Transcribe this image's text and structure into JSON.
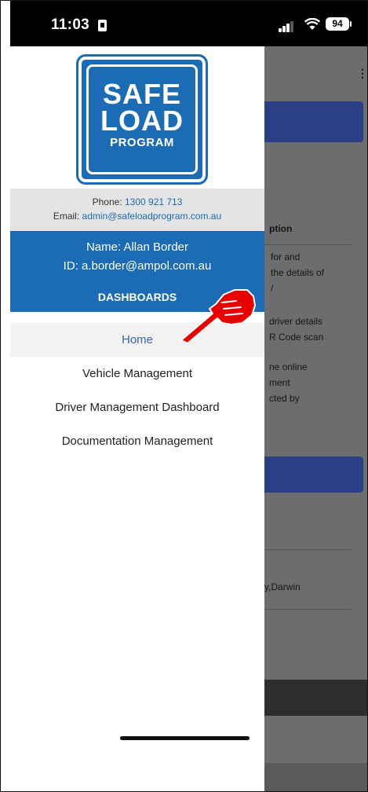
{
  "status_bar": {
    "time": "11:03",
    "battery": "94"
  },
  "drawer": {
    "logo": {
      "line1": "SAFE",
      "line2": "LOAD",
      "line3": "PROGRAM"
    },
    "contact": {
      "phone_label": "Phone:",
      "phone_value": "1300 921 713",
      "email_label": "Email:",
      "email_value": "admin@safeloadprogram.com.au"
    },
    "user": {
      "name_line": "Name: Allan Border",
      "id_line": "ID: a.border@ampol.com.au"
    },
    "section_title": "DASHBOARDS",
    "menu": [
      {
        "label": "Home",
        "active": true
      },
      {
        "label": "Vehicle Management",
        "active": false
      },
      {
        "label": "Driver Management Dashboard",
        "active": false
      },
      {
        "label": "Documentation Management",
        "active": false
      }
    ]
  },
  "background_app": {
    "heading": "ption",
    "para1": "for and\nthe details of\n/",
    "para2": "driver details\nR Code scan",
    "para3": "ne online\nment\ncted by",
    "location": "y,Darwin"
  },
  "colors": {
    "brand_blue": "#1b6bb5",
    "band_navy": "#2a3f86",
    "overlay_grey": "#6d6d6f",
    "pointer_red": "#e60000"
  }
}
